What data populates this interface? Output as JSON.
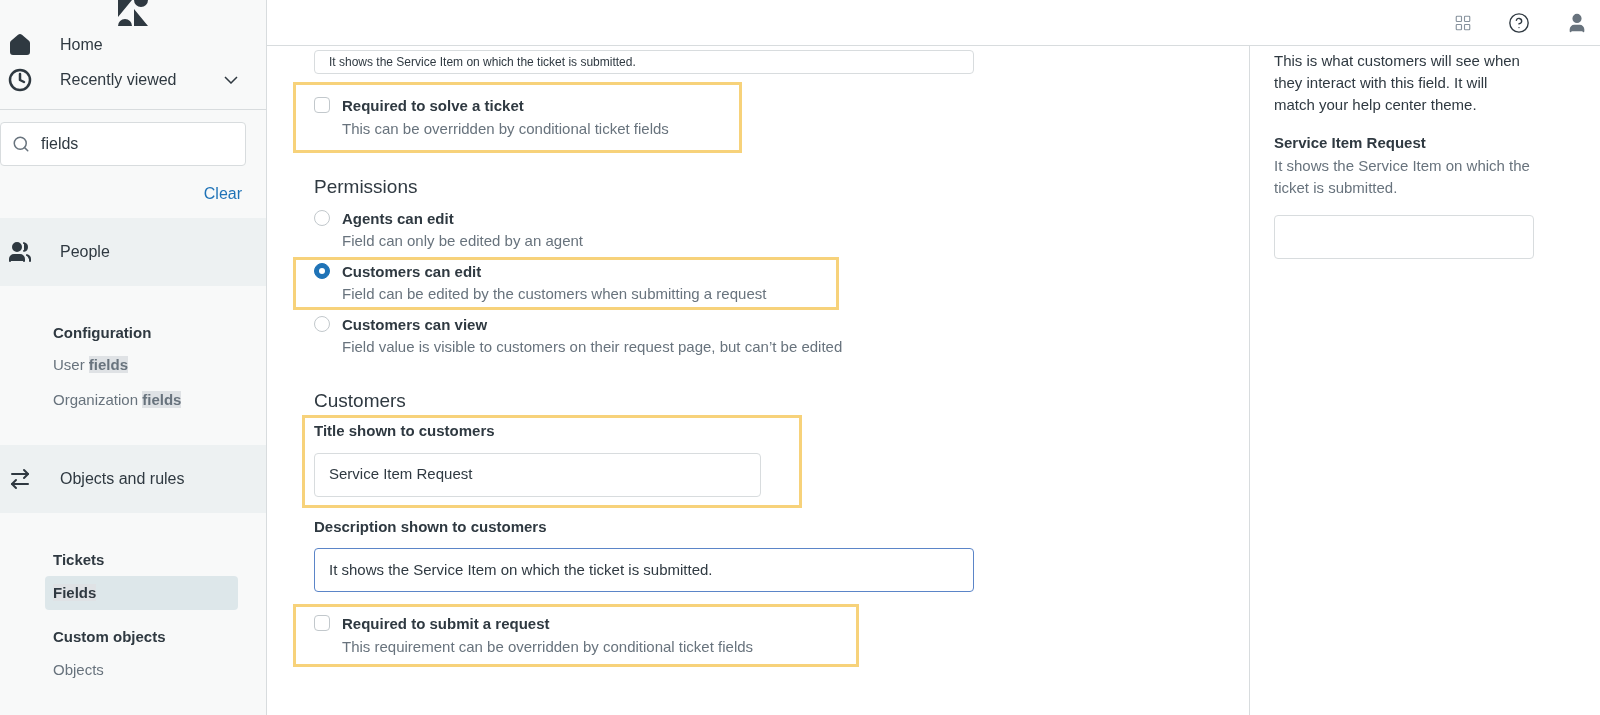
{
  "sidebar": {
    "nav": [
      {
        "kind": "home",
        "label": "Home"
      },
      {
        "kind": "recent",
        "label": "Recently viewed",
        "expanded": false
      }
    ],
    "search": {
      "value": "fields"
    },
    "clear_link": "Clear",
    "sections": [
      {
        "kind": "people",
        "label": "People",
        "groups": [
          {
            "heading": "Configuration",
            "items": [
              {
                "text": "User ",
                "match": "fields",
                "selected": false
              },
              {
                "text": "Organization ",
                "match": "fields",
                "selected": false
              }
            ]
          }
        ]
      },
      {
        "kind": "objects",
        "label": "Objects and rules",
        "groups": [
          {
            "heading": "Tickets",
            "items": [
              {
                "match": "Fields",
                "selected": true
              }
            ]
          },
          {
            "heading": "Custom objects",
            "items": [
              {
                "text": "Objects",
                "selected": false
              }
            ]
          }
        ]
      }
    ]
  },
  "main": {
    "top_field_value": "It shows the Service Item on which the ticket is submitted.",
    "solve_checkbox": {
      "label": "Required to solve a ticket",
      "hint": "This can be overridden by conditional ticket fields",
      "checked": false,
      "highlighted": true
    },
    "permissions": {
      "heading": "Permissions",
      "options": [
        {
          "label": "Agents can edit",
          "hint": "Field can only be edited by an agent",
          "selected": false,
          "highlighted": false
        },
        {
          "label": "Customers can edit",
          "hint": "Field can be edited by the customers when submitting a request",
          "selected": true,
          "highlighted": true
        },
        {
          "label": "Customers can view",
          "hint": "Field value is visible to customers on their request page, but can’t be edited",
          "selected": false,
          "highlighted": false
        }
      ]
    },
    "customers": {
      "heading": "Customers",
      "title_field": {
        "label": "Title shown to customers",
        "value": "Service Item Request",
        "highlighted": true
      },
      "description_field": {
        "label": "Description shown to customers",
        "value": "It shows the Service Item on which the ticket is submitted.",
        "focused": true
      },
      "submit_checkbox": {
        "label": "Required to submit a request",
        "hint": "This requirement can be overridden by conditional ticket fields",
        "checked": false,
        "highlighted": true
      }
    }
  },
  "preview": {
    "intro": "This is what customers will see when they interact with this field. It will match your help center theme.",
    "title": "Service Item Request",
    "description": "It shows the Service Item on which the ticket is submitted."
  }
}
